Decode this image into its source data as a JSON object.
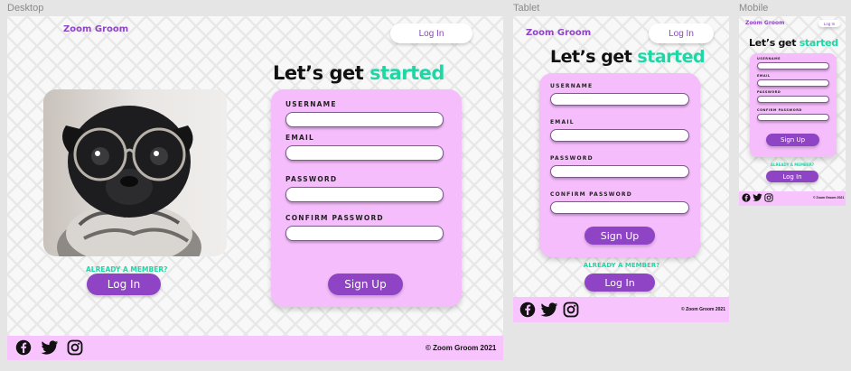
{
  "frames": {
    "desktop": "Desktop",
    "tablet": "Tablet",
    "mobile": "Mobile"
  },
  "brand": "Zoom Groom",
  "nav": {
    "login_label": "Log In"
  },
  "headline": {
    "prefix": "Let’s get",
    "accent": "started"
  },
  "form": {
    "username_label": "USERNAME",
    "email_label": "EMAIL",
    "password_label": "PASSWORD",
    "confirm_label": "CONFIRM PASSWORD",
    "submit_label": "Sign Up"
  },
  "member": {
    "text": "ALREADY A MEMBER?",
    "login_label": "Log In"
  },
  "footer": {
    "copyright": "© Zoom Groom 2021",
    "icons": [
      "facebook-icon",
      "twitter-icon",
      "instagram-icon"
    ]
  },
  "colors": {
    "brand_purple": "#8e44c4",
    "accent_green": "#1ed7a5",
    "card_pink": "#f5bdfb",
    "footer_pink": "#f8c4fd"
  }
}
